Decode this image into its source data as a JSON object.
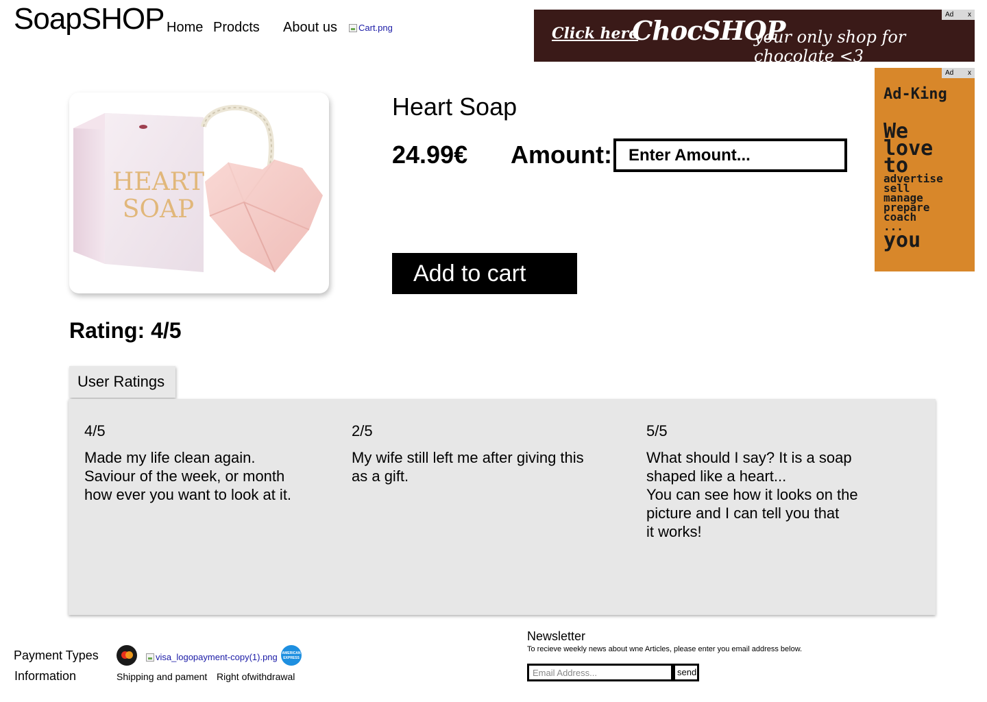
{
  "header": {
    "logo": "SoapSHOP",
    "nav": [
      "Home",
      "Prodcts",
      "About us"
    ],
    "cart_image_alt": "Cart.png"
  },
  "ads": {
    "badge_label": "Ad",
    "close_label": "x",
    "top": {
      "click_text": "Click here",
      "brand": "ChocSHOP",
      "tagline": "your only shop for chocolate <3",
      "background_color": "#3a1a18"
    },
    "side": {
      "brand": "Ad-King",
      "big_lines": [
        "We",
        "love",
        "to"
      ],
      "small_lines": [
        "advertise",
        "sell",
        "manage",
        "prepare",
        "coach",
        "..."
      ],
      "last_line": "you",
      "background_color": "#d8872a"
    }
  },
  "product": {
    "title": "Heart Soap",
    "price": "24.99€",
    "amount_label": "Amount:",
    "amount_placeholder": "Enter Amount...",
    "add_to_cart_label": "Add to cart",
    "box_text": "HEART SOAP"
  },
  "rating": {
    "label": "Rating: 4/5",
    "value": 4,
    "max": 5
  },
  "user_ratings": {
    "tab_label": "User Ratings",
    "reviews": [
      {
        "score": "4/5",
        "text": "Made my life clean again.\nSaviour of the week, or month\nhow ever you want to look at it."
      },
      {
        "score": "2/5",
        "text": "My wife still left me after giving this\nas a gift."
      },
      {
        "score": "5/5",
        "text": "What should I say? It is a soap\nshaped like a heart...\nYou can see how it looks on the\npicture and I can tell you that\nit works!"
      }
    ]
  },
  "footer": {
    "payment_label": "Payment Types",
    "visa_image_alt": "visa_logopayment-copy(1).png",
    "amex_text": "AMERICAN EXPRESS",
    "information_label": "Information",
    "links": [
      "Shipping and pament",
      "Right ofwithdrawal"
    ],
    "newsletter": {
      "title": "Newsletter",
      "description": "To recieve weekly news about wne Articles, please enter you email address below.",
      "email_placeholder": "Email Address...",
      "send_label": "send"
    }
  }
}
